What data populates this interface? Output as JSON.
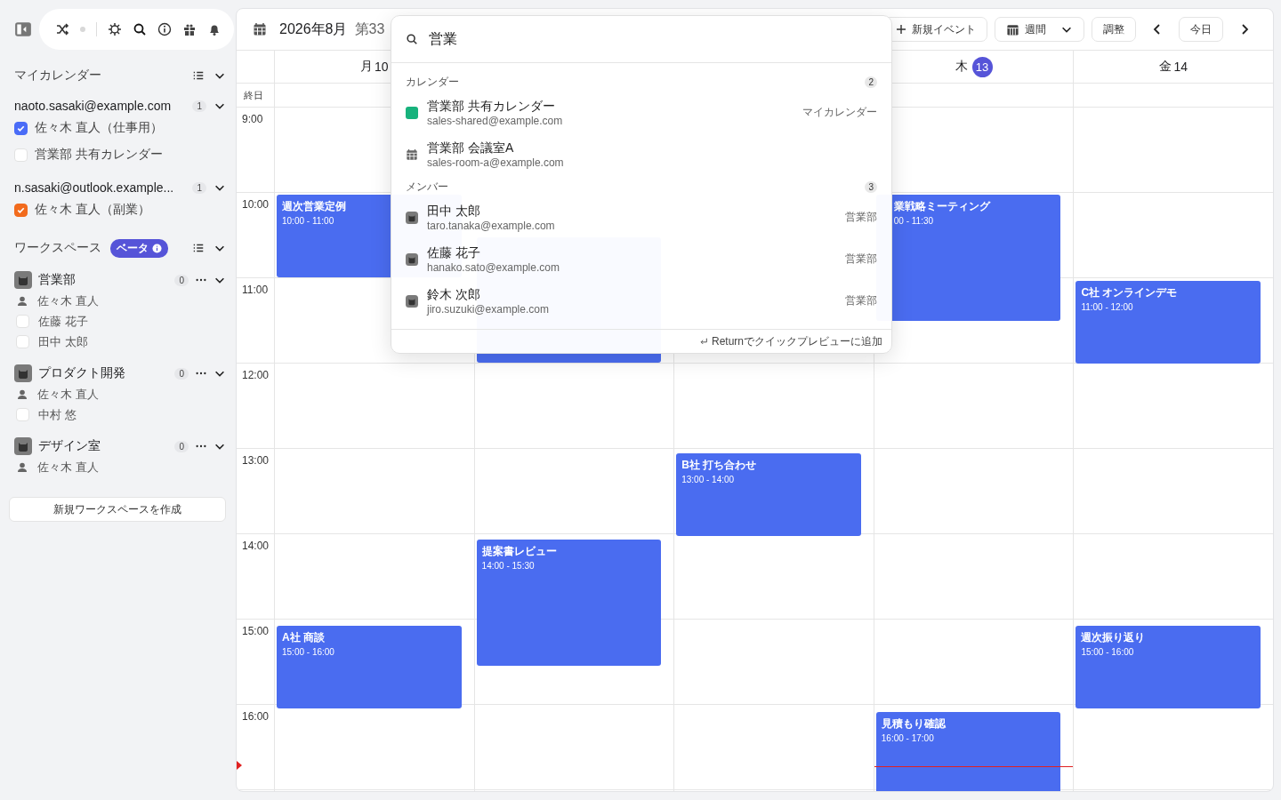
{
  "sidebar": {
    "my_calendars": {
      "title": "マイカレンダー",
      "accounts": [
        {
          "email": "naoto.sasaki@example.com",
          "count": "1",
          "calendars": [
            {
              "name": "佐々木 直人（仕事用）",
              "checked": true,
              "color": "#4a6cf7"
            },
            {
              "name": "営業部 共有カレンダー",
              "checked": false
            }
          ]
        },
        {
          "email": "n.sasaki@outlook.example...",
          "count": "1",
          "calendars": [
            {
              "name": "佐々木 直人（副業）",
              "checked": true,
              "color": "#f26b1d"
            }
          ]
        }
      ]
    },
    "workspaces": {
      "title": "ワークスペース",
      "badge": "ベータ",
      "items": [
        {
          "name": "営業部",
          "count": "0",
          "members": [
            {
              "kind": "self",
              "name": "佐々木 直人"
            },
            {
              "kind": "checkbox",
              "name": "佐藤 花子",
              "checked": false
            },
            {
              "kind": "checkbox",
              "name": "田中 太郎",
              "checked": false
            }
          ]
        },
        {
          "name": "プロダクト開発",
          "count": "0",
          "members": [
            {
              "kind": "self",
              "name": "佐々木 直人"
            },
            {
              "kind": "checkbox",
              "name": "中村 悠",
              "checked": false
            }
          ]
        },
        {
          "name": "デザイン室",
          "count": "0",
          "members": [
            {
              "kind": "self",
              "name": "佐々木 直人"
            }
          ]
        }
      ],
      "create_button": "新規ワークスペースを作成"
    }
  },
  "header": {
    "month": "2026年8月",
    "week": "第33",
    "new_event": "新規イベント",
    "view": "週間",
    "adjust": "調整",
    "today": "今日"
  },
  "all_day_label": "終日",
  "hours": [
    "9:00",
    "10:00",
    "11:00",
    "12:00",
    "13:00",
    "14:00",
    "15:00",
    "16:00"
  ],
  "columns": [
    {
      "weekday": "月",
      "date": "10",
      "today": false,
      "events": [
        {
          "kind": "event",
          "title": "週次営業定例",
          "time": "10:00 - 11:00",
          "partly_hidden": false
        },
        {
          "kind": "event",
          "title": "A社 商談",
          "time": "15:00 - 16:00",
          "partly_hidden": false
        }
      ]
    },
    {
      "events": [
        {
          "kind": "covered"
        },
        {
          "kind": "event",
          "title": "提案書レビュー",
          "time": "14:00 - 15:30",
          "partly_hidden": false
        }
      ]
    },
    {
      "events": [
        {
          "kind": "event",
          "title": "B社 打ち合わせ",
          "time": "13:00 - 14:00",
          "partly_hidden": false
        }
      ]
    },
    {
      "weekday": "木",
      "date": "13",
      "today": true,
      "events": [
        {
          "kind": "event",
          "title": "業戦略ミーティング",
          "time": "00 - 11:30",
          "partly_hidden": true
        },
        {
          "kind": "event",
          "title": "見積もり確認",
          "time": "16:00 - 17:00",
          "partly_hidden": false
        }
      ]
    },
    {
      "weekday": "金",
      "date": "14",
      "today": false,
      "events": [
        {
          "kind": "event",
          "title": "C社 オンラインデモ",
          "time": "11:00 - 12:00",
          "partly_hidden": false
        },
        {
          "kind": "event",
          "title": "週次振り返り",
          "time": "15:00 - 16:00",
          "partly_hidden": false
        }
      ]
    }
  ],
  "search_popup": {
    "query": "営業",
    "sections": [
      {
        "title": "カレンダー",
        "count": "2",
        "items": [
          {
            "kind": "color",
            "color": "#17b27c",
            "name": "営業部 共有カレンダー",
            "email": "sales-shared@example.com",
            "group": "マイカレンダー"
          },
          {
            "kind": "room",
            "name": "営業部 会議室A",
            "email": "sales-room-a@example.com"
          }
        ]
      },
      {
        "title": "メンバー",
        "count": "3",
        "items": [
          {
            "kind": "member",
            "name": "田中 太郎",
            "email": "taro.tanaka@example.com",
            "group": "営業部"
          },
          {
            "kind": "member",
            "name": "佐藤 花子",
            "email": "hanako.sato@example.com",
            "group": "営業部"
          },
          {
            "kind": "member",
            "name": "鈴木 次郎",
            "email": "jiro.suzuki@example.com",
            "group": "営業部"
          }
        ]
      }
    ],
    "footer": "Returnでクイックプレビューに追加"
  }
}
